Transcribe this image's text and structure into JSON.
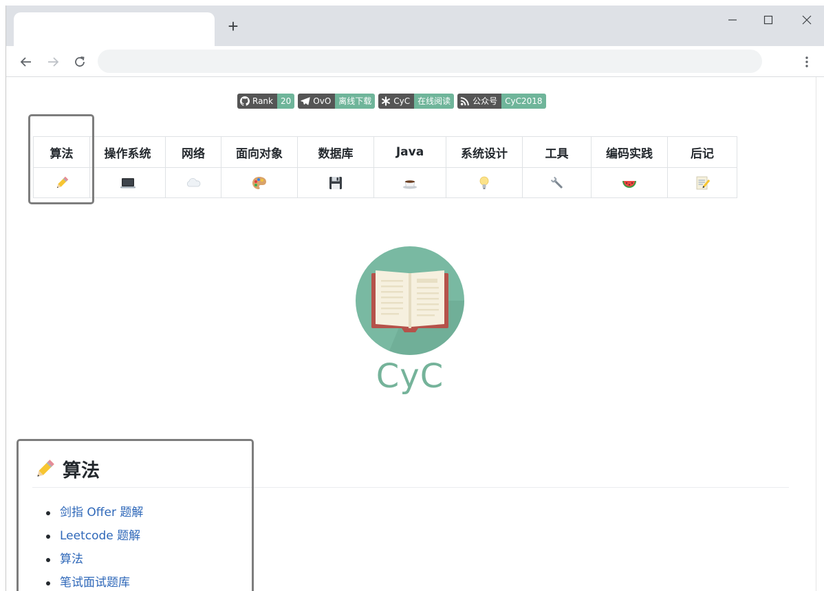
{
  "browser": {
    "tab_title": "",
    "new_tab_label": "+",
    "address": "",
    "window_controls": [
      "minimize-icon",
      "maximize-icon",
      "close-icon"
    ]
  },
  "badges": [
    {
      "icon": "github-icon",
      "label": "Rank",
      "value": "20",
      "color": "#6fb59a"
    },
    {
      "icon": "telegram-icon",
      "label": "OvO",
      "value": "离线下载",
      "color": "#6fb59a"
    },
    {
      "icon": "asterisk-icon",
      "label": "CyC",
      "value": "在线阅读",
      "color": "#6fb59a"
    },
    {
      "icon": "rss-icon",
      "label": "公众号",
      "value": "CyC2018",
      "color": "#6fb59a"
    }
  ],
  "nav_table": {
    "headers": [
      "算法",
      "操作系统",
      "网络",
      "面向对象",
      "数据库",
      "Java",
      "系统设计",
      "工具",
      "编码实践",
      "后记"
    ],
    "icons": [
      "pencil-icon",
      "laptop-icon",
      "cloud-icon",
      "palette-icon",
      "floppy-disk-icon",
      "coffee-icon",
      "lightbulb-icon",
      "wrench-icon",
      "watermelon-icon",
      "memo-icon"
    ]
  },
  "logo": {
    "text": "CyC",
    "accent": "#75b39a"
  },
  "section": {
    "icon": "pencil-icon",
    "title": "算法",
    "links": [
      "剑指 Offer 题解",
      "Leetcode 题解",
      "算法",
      "笔试面试题库"
    ]
  },
  "colors": {
    "link": "#2f68b9",
    "highlight_border": "#7d7d7d",
    "badge_left": "#555555"
  }
}
